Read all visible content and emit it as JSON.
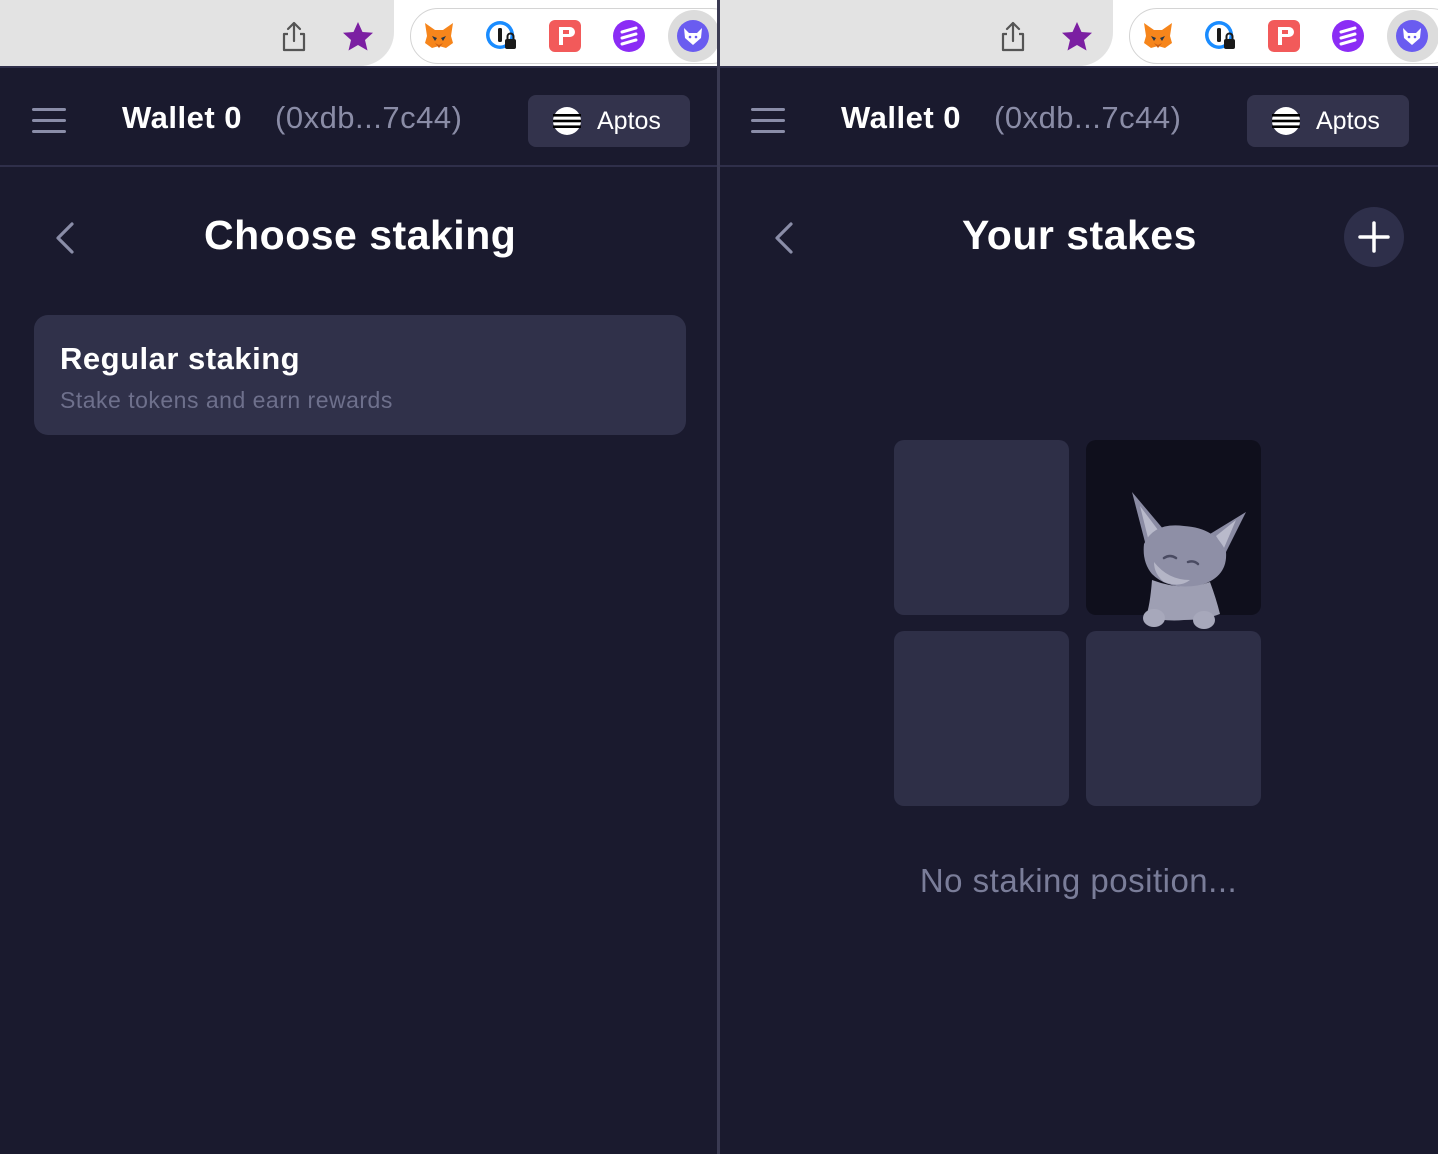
{
  "panels": [
    {
      "header": {
        "wallet_name": "Wallet 0",
        "wallet_address": "(0xdb...7c44)",
        "network_label": "Aptos"
      },
      "page": {
        "title": "Choose staking"
      },
      "options": [
        {
          "title": "Regular staking",
          "subtitle": "Stake tokens and earn rewards"
        }
      ]
    },
    {
      "header": {
        "wallet_name": "Wallet 0",
        "wallet_address": "(0xdb...7c44)",
        "network_label": "Aptos"
      },
      "page": {
        "title": "Your stakes",
        "empty_message": "No staking position..."
      }
    }
  ],
  "browser": {
    "toolbar_icons": [
      "share-icon",
      "bookmark-star-icon"
    ],
    "extensions": [
      "metamask-fox-icon",
      "onepassword-icon",
      "pin-app-icon",
      "circle-b-icon",
      "wallet-fox-icon"
    ]
  },
  "icons": {
    "menu": "hamburger-menu-icon",
    "network": "aptos-logo-icon",
    "back": "chevron-left-icon",
    "add": "plus-icon",
    "empty_state": "fox-mascot-icon"
  },
  "colors": {
    "background": "#1a1a2e",
    "card": "#30314a",
    "button": "#33334c",
    "muted_text": "#7a7d99",
    "star": "#7b1fa2"
  }
}
